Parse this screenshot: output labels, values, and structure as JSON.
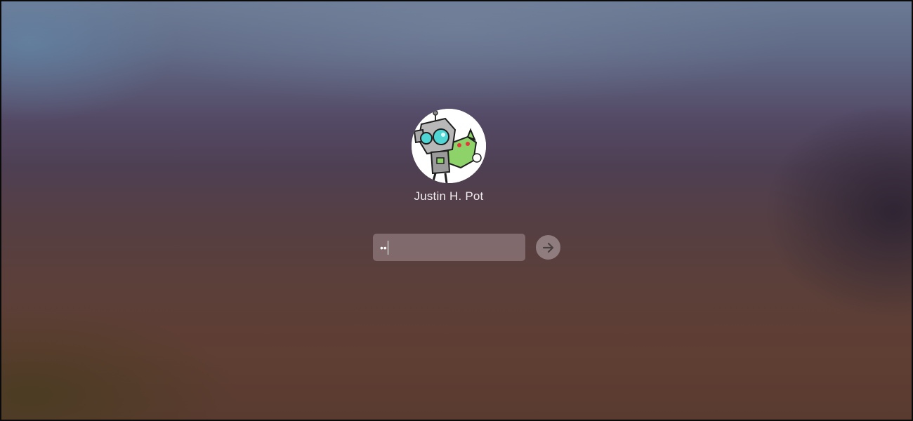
{
  "login": {
    "user_name": "Justin H. Pot",
    "password_masked": "••",
    "avatar_icon": "robot-character-avatar",
    "submit_icon": "arrow-right-icon"
  },
  "colors": {
    "name_text": "#f2eef0",
    "field_fill": "#8c7371",
    "avatar_green": "#8dd36a",
    "avatar_cyan": "#4fd6d4",
    "avatar_gray": "#b8b8b8"
  }
}
